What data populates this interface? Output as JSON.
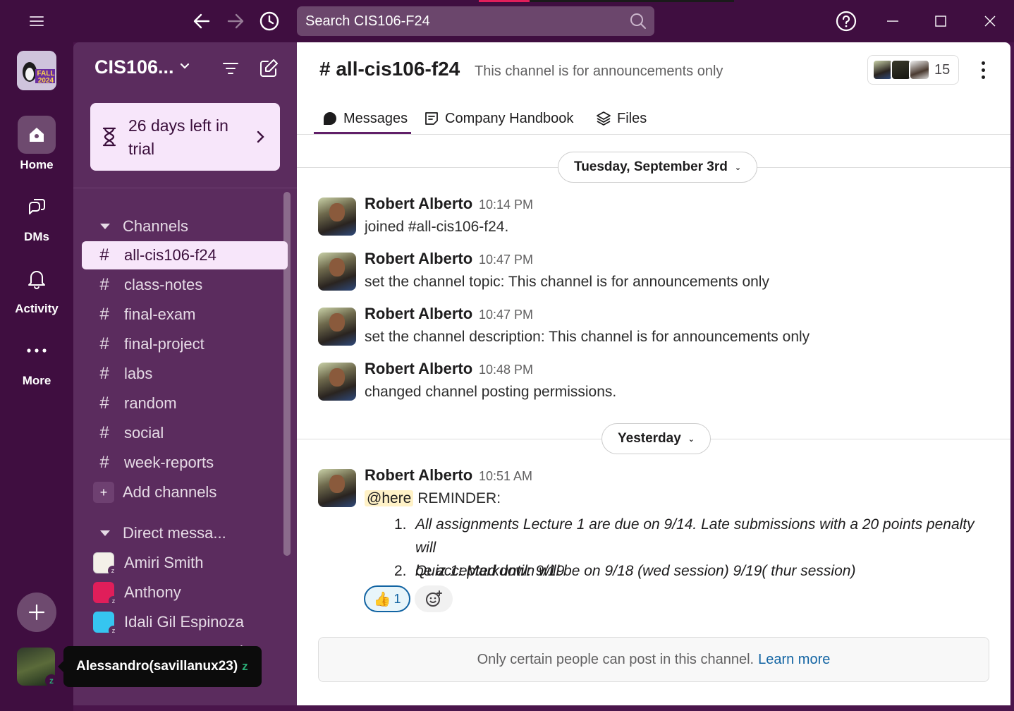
{
  "titlebar": {
    "search_placeholder": "Search CIS106-F24"
  },
  "rail": {
    "workspace_logo_text": "FALL 2024",
    "home_label": "Home",
    "dms_label": "DMs",
    "activity_label": "Activity",
    "more_label": "More"
  },
  "user": {
    "tooltip_name": "Alessandro(savillanux23)",
    "tooltip_status": "z"
  },
  "sidebar": {
    "workspace_name": "CIS106...",
    "trial_text": "26 days left in trial",
    "channels_header": "Channels",
    "channels": [
      {
        "name": "all-cis106-f24"
      },
      {
        "name": "class-notes"
      },
      {
        "name": "final-exam"
      },
      {
        "name": "final-project"
      },
      {
        "name": "labs"
      },
      {
        "name": "random"
      },
      {
        "name": "social"
      },
      {
        "name": "week-reports"
      }
    ],
    "add_channels_label": "Add channels",
    "dm_header": "Direct messa...",
    "dms": [
      {
        "name": "Amiri Smith",
        "avatar_color": "#f4f0e8"
      },
      {
        "name": "Anthony",
        "avatar_color": "#e01e5a"
      },
      {
        "name": "Idali Gil Espinoza",
        "avatar_color": "#36c5f0"
      }
    ],
    "hidden_dm_suffix": "l..."
  },
  "channel": {
    "title": "# all-cis106-f24",
    "description": "This channel is for announcements only",
    "member_count": "15",
    "tabs": {
      "messages": "Messages",
      "handbook": "Company Handbook",
      "files": "Files"
    }
  },
  "dates": {
    "first": "Tuesday, September 3rd",
    "second": "Yesterday"
  },
  "messages": [
    {
      "author": "Robert Alberto",
      "time": "10:14 PM",
      "text": "joined #all-cis106-f24."
    },
    {
      "author": "Robert Alberto",
      "time": "10:47 PM",
      "text": "set the channel topic: This channel is for announcements only"
    },
    {
      "author": "Robert Alberto",
      "time": "10:47 PM",
      "text": "set the channel description: This channel is for announcements only"
    },
    {
      "author": "Robert Alberto",
      "time": "10:48 PM",
      "text": "changed channel posting permissions."
    },
    {
      "author": "Robert Alberto",
      "time": "10:51 AM",
      "mention": "@here",
      "text": "REMINDER:",
      "list": [
        {
          "num": "1.",
          "line1": "All assignments Lecture 1 are due on 9/14. Late submissions with a 20 points penalty will",
          "line2": "be accepted until: 9/19"
        },
        {
          "num": "2.",
          "line1": "Quiz 1: Markdown will be on 9/18 (wed session) 9/19( thur session)"
        }
      ],
      "reaction": {
        "emoji": "👍",
        "count": "1"
      }
    }
  ],
  "notice": {
    "text": "Only certain people can post in this channel.",
    "link": "Learn more"
  },
  "colors": {
    "aubergine": "#4a154b",
    "sidebar": "#5b2c5e",
    "link": "#1264a3",
    "presence": "#2bac76"
  }
}
